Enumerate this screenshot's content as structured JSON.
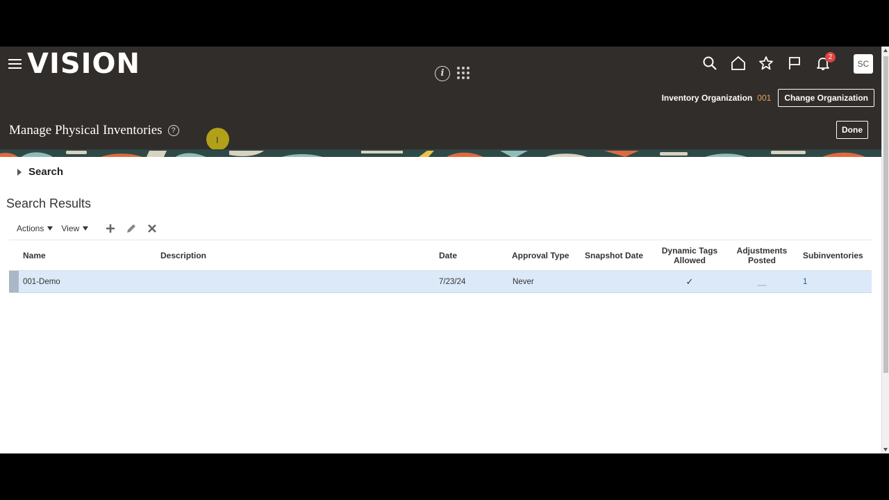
{
  "header": {
    "brand": "VISION",
    "inventory_org_label": "Inventory Organization",
    "inventory_org_value": "001",
    "change_org_label": "Change Organization",
    "notification_count": "2",
    "user_initials": "SC",
    "icons": [
      "menu-icon",
      "info-icon",
      "app-grid-icon",
      "search-icon",
      "home-icon",
      "favorites-star-icon",
      "flag-icon",
      "bell-icon"
    ]
  },
  "page": {
    "title": "Manage Physical Inventories",
    "done_label": "Done"
  },
  "search": {
    "label": "Search"
  },
  "results": {
    "title": "Search Results",
    "toolbar": {
      "actions_label": "Actions",
      "view_label": "View"
    },
    "columns": {
      "name": "Name",
      "description": "Description",
      "date": "Date",
      "approval_type": "Approval Type",
      "snapshot_date": "Snapshot Date",
      "dynamic_tags_line1": "Dynamic Tags",
      "dynamic_tags_line2": "Allowed",
      "adjustments_line1": "Adjustments",
      "adjustments_line2": "Posted",
      "subinventories": "Subinventories"
    },
    "rows": [
      {
        "name": "001-Demo",
        "description": "",
        "date": "7/23/24",
        "approval_type": "Never",
        "snapshot_date": "",
        "dynamic_tags_allowed": "✓",
        "adjustments_posted": "__",
        "subinventories": "1"
      }
    ]
  },
  "colors": {
    "header_bg": "#312d2a",
    "selected_row_bg": "#dbe9f8",
    "link": "#1f5c99",
    "org_value": "#e0a84c",
    "badge": "#dd4444"
  }
}
